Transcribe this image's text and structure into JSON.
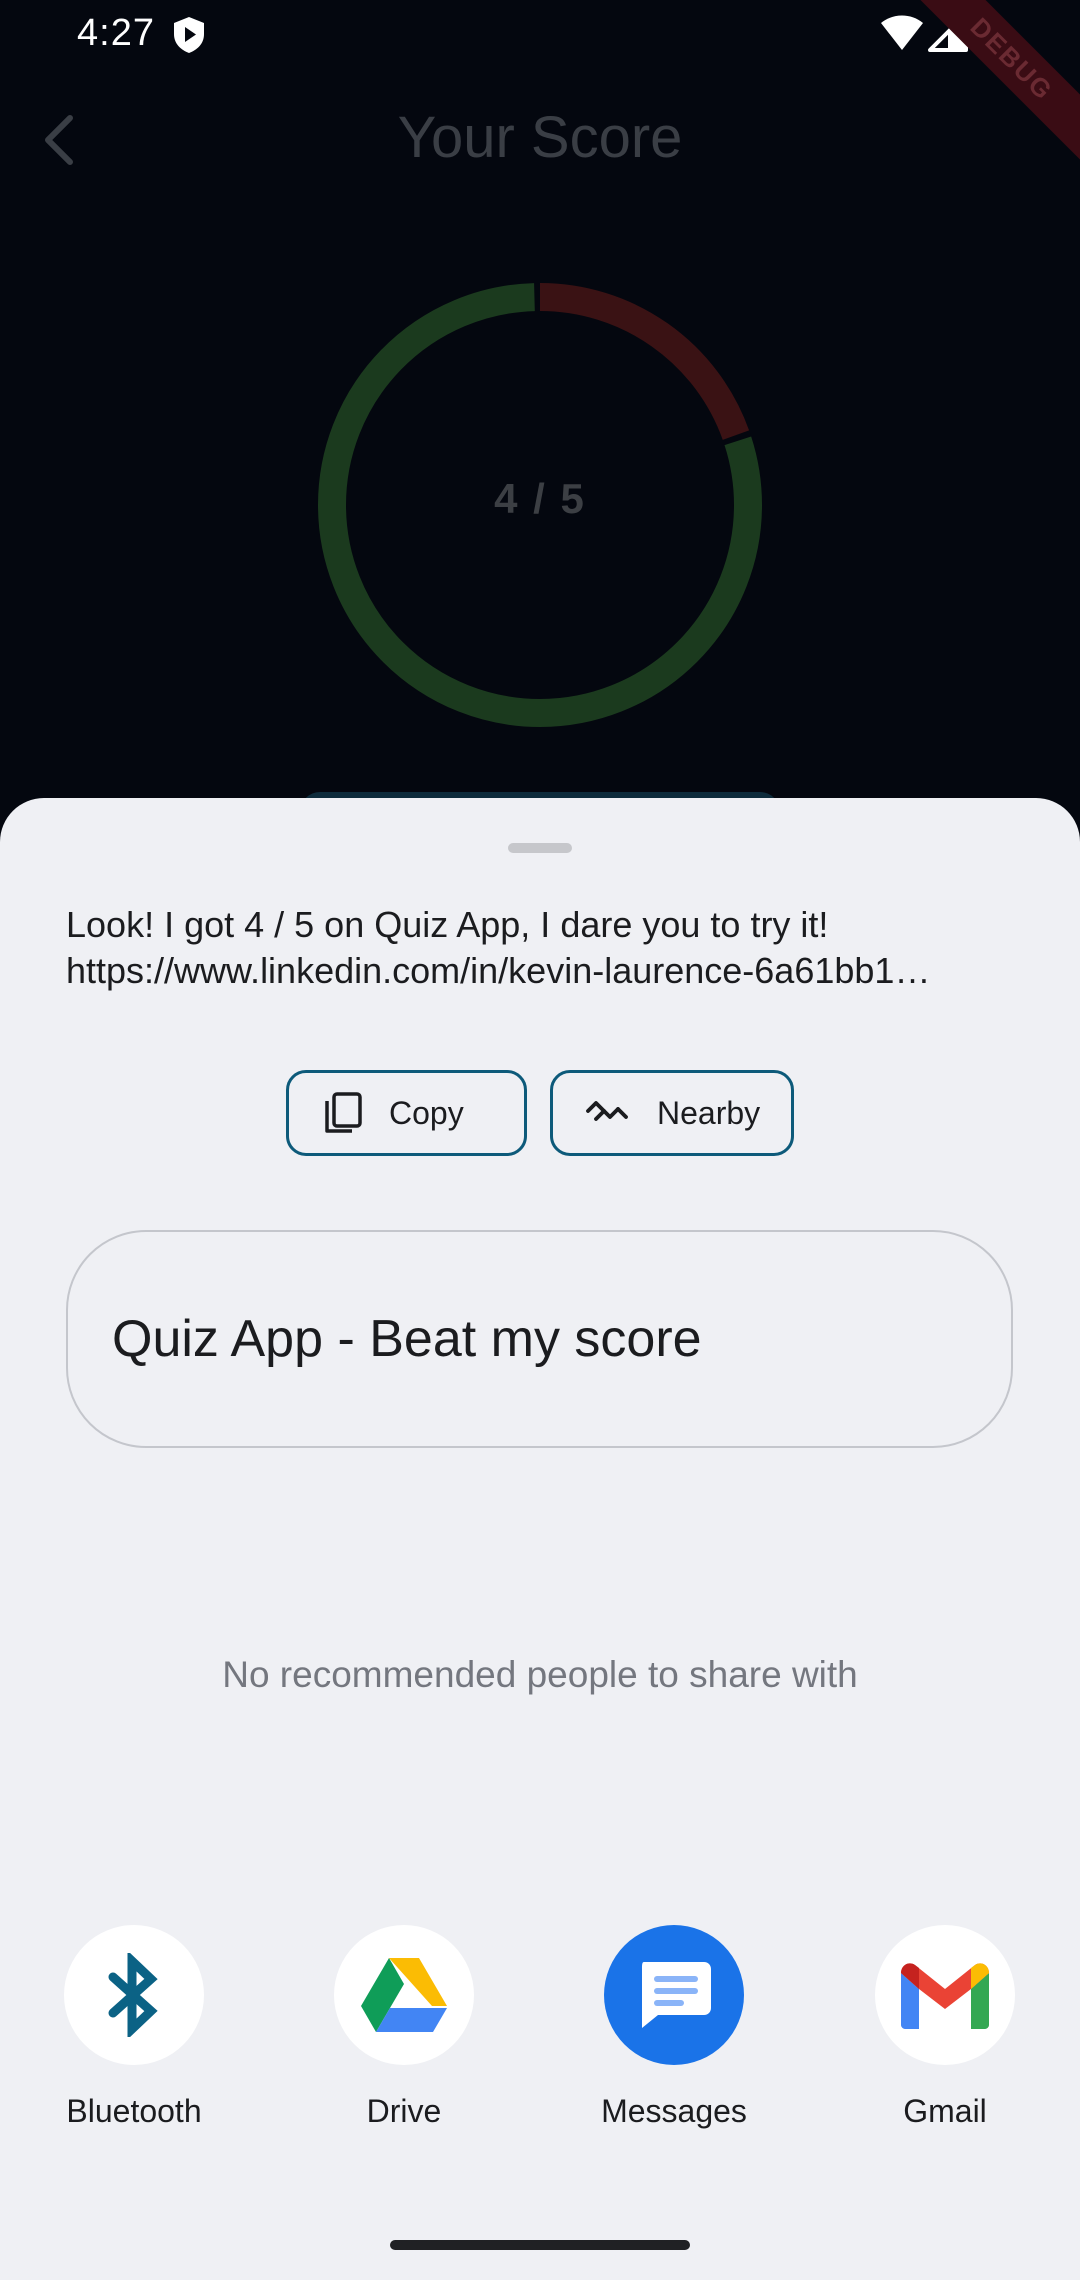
{
  "status_bar": {
    "time": "4:27",
    "debug_label": "DEBUG"
  },
  "app": {
    "title": "Your Score",
    "score_text": "4 / 5",
    "score_fraction": 0.8,
    "colors": {
      "correct": "#1b3a1e",
      "incorrect": "#3a1214",
      "background": "#04070f"
    }
  },
  "share_sheet": {
    "text_line1": "Look! I got 4 / 5 on Quiz App, I dare you to try it!",
    "text_line2": "https://www.linkedin.com/in/kevin-laurence-6a61bb1…",
    "chips": {
      "copy": "Copy",
      "nearby": "Nearby"
    },
    "title_field": "Quiz App - Beat my score",
    "no_recommendations": "No recommended people to share with",
    "targets": [
      {
        "label": "Bluetooth",
        "icon": "bluetooth-icon"
      },
      {
        "label": "Drive",
        "icon": "drive-icon"
      },
      {
        "label": "Messages",
        "icon": "messages-icon"
      },
      {
        "label": "Gmail",
        "icon": "gmail-icon"
      }
    ],
    "accent_color": "#0d5a7a"
  }
}
